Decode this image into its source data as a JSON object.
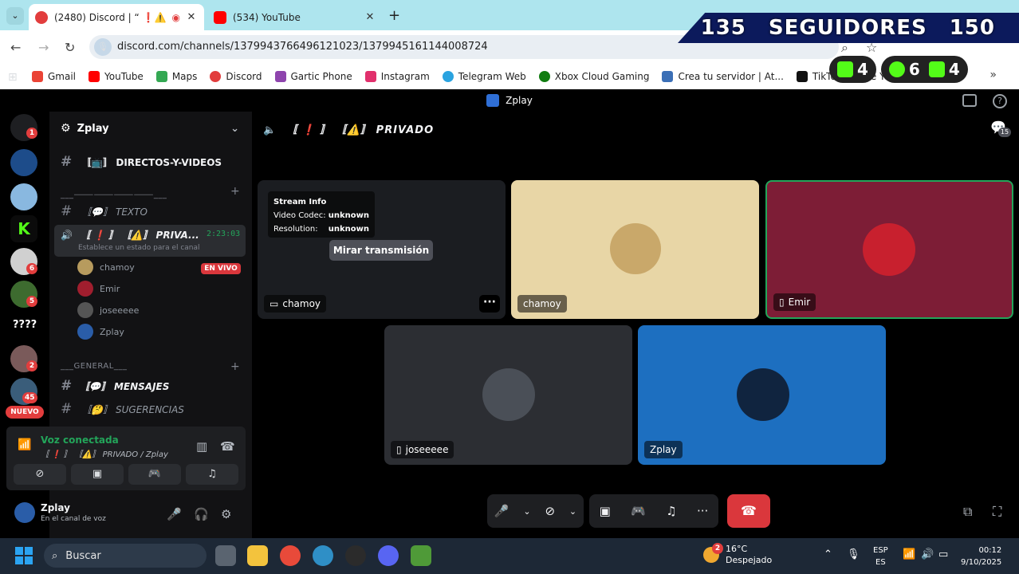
{
  "browser": {
    "tabs": [
      {
        "title": "(2480) Discord | “ ❗⚠️"
      },
      {
        "title": "(534) YouTube"
      }
    ],
    "url": "discord.com/channels/1379943766496121023/1379945161144008724",
    "bookmarks": [
      "Gmail",
      "YouTube",
      "Maps",
      "Discord",
      "Gartic Phone",
      "Instagram",
      "Telegram Web",
      "Xbox Cloud Gaming",
      "Crea tu servidor | At...",
      "TikTok - Make Your..."
    ]
  },
  "overlay": {
    "left": "135",
    "center": "SEGUIDORES",
    "right": "150",
    "badge1": "4",
    "badge2": "6",
    "badge3": "4"
  },
  "discord": {
    "window_title": "Zplay",
    "server_name": "Zplay",
    "channels": {
      "directos": "〚📺〛 DIRECTOS-Y-VIDEOS",
      "cat1": "___⸻⸻⸻⸻___",
      "texto": "〚💬〛 TEXTO",
      "voice": "〚 ❗ 〛 〚⚠️〛 PRIVA...",
      "voice_time": "2:23:03",
      "voice_status": "Establece un estado para el canal",
      "cat2": "___GENERAL___",
      "mensajes": "〚💬〛 MENSAJES",
      "sugerencias": "〚🤔〛 SUGERENCIAS"
    },
    "members": [
      "chamoy",
      "Emir",
      "joseeeee",
      "Zplay"
    ],
    "live_label": "EN VIVO",
    "server_badges": [
      "1",
      "6",
      "5",
      "2",
      "45"
    ],
    "server_qmarks": "????",
    "nuevo": "NUEVO",
    "voice_panel": {
      "title": "Voz conectada",
      "sub": "〚 ❗ 〛 〚⚠️〛 PRIVADO / Zplay"
    },
    "user": {
      "name": "Zplay",
      "status": "En el canal de voz"
    },
    "stage": {
      "channel_title": "〚 ❗ 〛 〚⚠️〛 PRIVADO",
      "chat_count": "15",
      "stream_info": {
        "title": "Stream Info",
        "codec_label": "Video Codec:",
        "codec_value": "unknown",
        "res_label": "Resolution:",
        "res_value": "unknown"
      },
      "watch_button": "Mirar transmisión",
      "tiles": [
        "chamoy",
        "chamoy",
        "Emir",
        "joseeeee",
        "Zplay"
      ]
    }
  },
  "taskbar": {
    "search": "Buscar",
    "weather_temp": "16°C",
    "weather_desc": "Despejado",
    "weather_badge": "2",
    "lang1": "ESP",
    "lang2": "ES",
    "time": "00:12",
    "date": "9/10/2025"
  },
  "colors": {
    "discord_bg": "#000000",
    "sidebar_bg": "#121214",
    "green": "#23a55a",
    "red": "#da373c"
  }
}
